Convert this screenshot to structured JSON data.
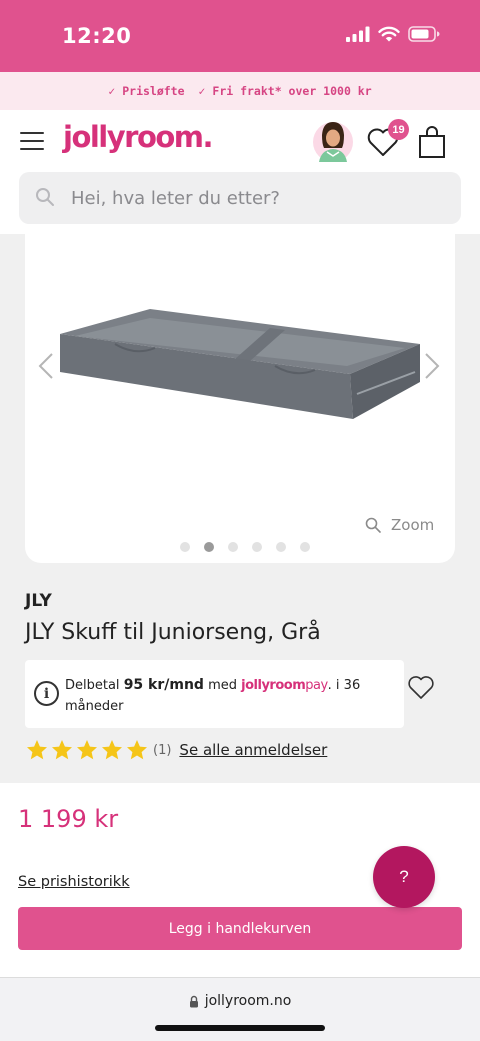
{
  "status_bar": {
    "time": "12:20"
  },
  "usp_bar": {
    "items": [
      "Prisløfte",
      "Fri frakt* over 1000 kr"
    ]
  },
  "header": {
    "logo": "jollyroom.",
    "wishlist_count": "19"
  },
  "search": {
    "placeholder": "Hei, hva leter du etter?"
  },
  "gallery": {
    "zoom_label": "Zoom",
    "image_count": 6,
    "active_index": 1
  },
  "product": {
    "brand": "JLY",
    "title": "JLY Skuff til Juniorseng, Grå",
    "price": "1 199 kr",
    "rating": 5,
    "review_count": "(1)",
    "reviews_link": "Se alle anmeldelser",
    "price_history_link": "Se prishistorikk",
    "add_to_cart_label": "Legg i handlekurven"
  },
  "payment": {
    "prefix": "Delbetal",
    "amount": "95 kr/mnd",
    "middle": "med",
    "brand_main": "jollyroom",
    "brand_suffix": "pay",
    "suffix": ". i 36 måneder"
  },
  "help": {
    "label": "?"
  },
  "browser": {
    "url": "jollyroom.no"
  },
  "colors": {
    "brand_pink": "#e0528e",
    "price_pink": "#d6317a",
    "help_button": "#b3175f",
    "star": "#f5c518"
  }
}
